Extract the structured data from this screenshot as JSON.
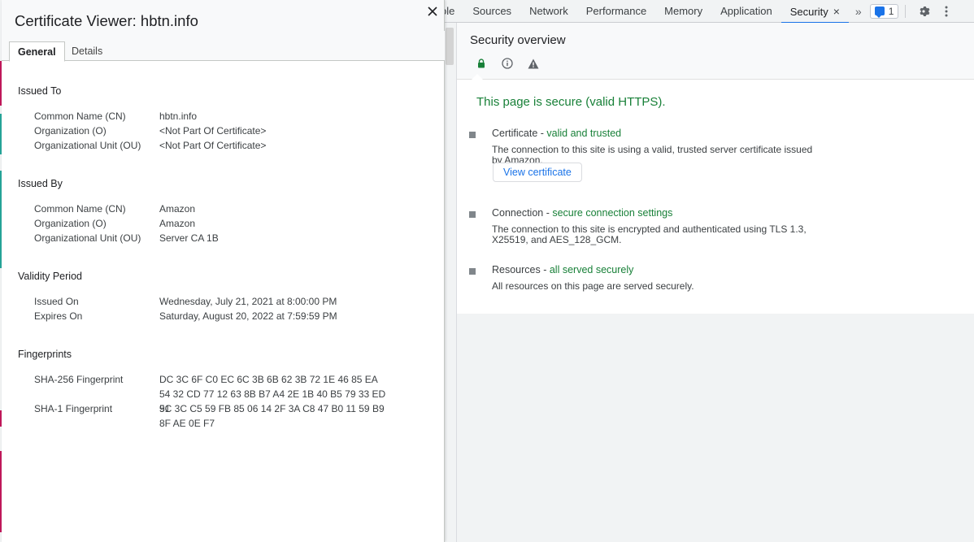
{
  "devtools": {
    "tabs": [
      {
        "label": "ole"
      },
      {
        "label": "Sources"
      },
      {
        "label": "Network"
      },
      {
        "label": "Performance"
      },
      {
        "label": "Memory"
      },
      {
        "label": "Application"
      },
      {
        "label": "Security"
      }
    ],
    "active_tab_close": "×",
    "more_tabs": "»",
    "issues_count": "1",
    "accent_color": "#1a73e8"
  },
  "security": {
    "title": "Security overview",
    "summary": "This page is secure (valid HTTPS).",
    "items": [
      {
        "label": "Certificate",
        "status": "valid and trusted",
        "desc": "The connection to this site is using a valid, trusted server certificate issued by Amazon.",
        "button": "View certificate"
      },
      {
        "label": "Connection",
        "status": "secure connection settings",
        "desc": "The connection to this site is encrypted and authenticated using TLS 1.3, X25519, and AES_128_GCM."
      },
      {
        "label": "Resources",
        "status": "all served securely",
        "desc": "All resources on this page are served securely."
      }
    ],
    "item_separator": " - ",
    "secure_color": "#188038"
  },
  "certificate": {
    "title": "Certificate Viewer: hbtn.info",
    "tabs": [
      {
        "label": "General"
      },
      {
        "label": "Details"
      }
    ],
    "sections": {
      "issued_to": {
        "title": "Issued To",
        "rows": [
          {
            "label": "Common Name (CN)",
            "value": "hbtn.info"
          },
          {
            "label": "Organization (O)",
            "value": "<Not Part Of Certificate>"
          },
          {
            "label": "Organizational Unit (OU)",
            "value": "<Not Part Of Certificate>"
          }
        ]
      },
      "issued_by": {
        "title": "Issued By",
        "rows": [
          {
            "label": "Common Name (CN)",
            "value": "Amazon"
          },
          {
            "label": "Organization (O)",
            "value": "Amazon"
          },
          {
            "label": "Organizational Unit (OU)",
            "value": "Server CA 1B"
          }
        ]
      },
      "validity": {
        "title": "Validity Period",
        "rows": [
          {
            "label": "Issued On",
            "value": "Wednesday, July 21, 2021 at 8:00:00 PM"
          },
          {
            "label": "Expires On",
            "value": "Saturday, August 20, 2022 at 7:59:59 PM"
          }
        ]
      },
      "fingerprints": {
        "title": "Fingerprints",
        "rows": [
          {
            "label": "SHA-256 Fingerprint",
            "value": "DC 3C 6F C0 EC 6C 3B 6B 62 3B 72 1E 46 85 EA 54 32 CD 77 12 63 8B B7 A4 2E 1B 40 B5 79 33 ED 51"
          },
          {
            "label": "SHA-1 Fingerprint",
            "value": "9C 3C C5 59 FB 85 06 14 2F 3A C8 47 B0 11 59 B9 8F AE 0E F7"
          }
        ]
      }
    }
  }
}
